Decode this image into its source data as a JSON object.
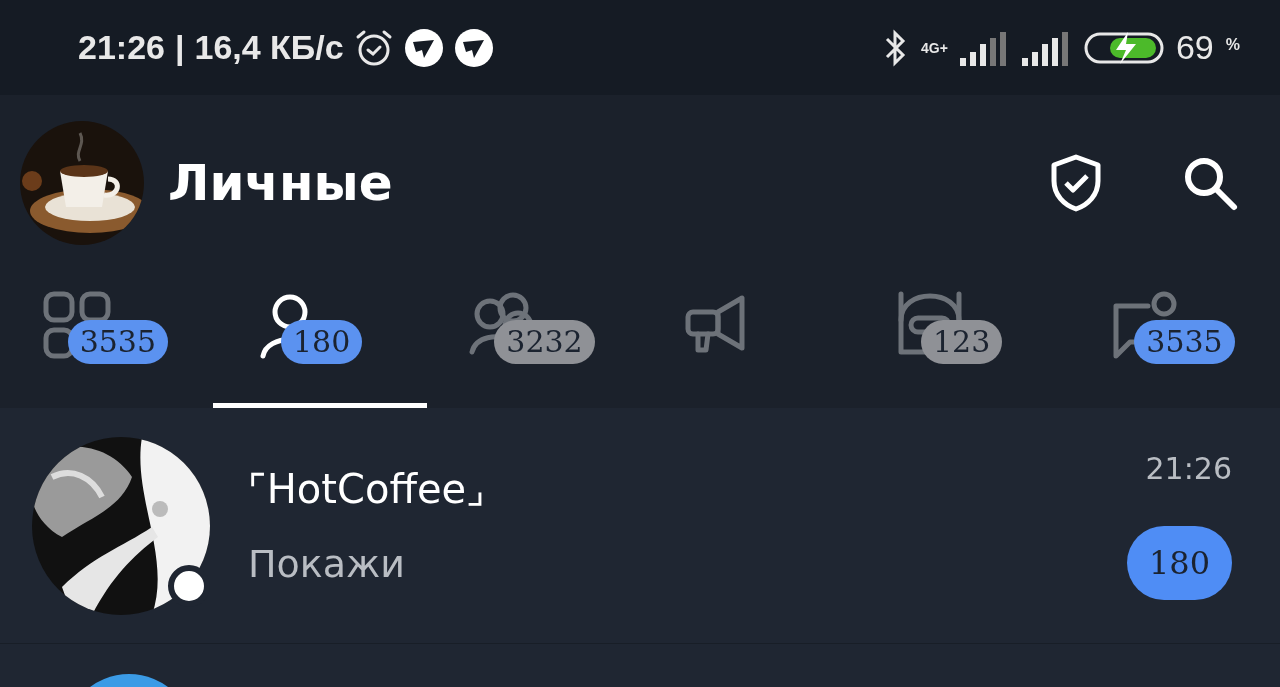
{
  "status_bar": {
    "time": "21:26",
    "separator": "|",
    "speed": "16,4 КБ/с",
    "network": "4G+",
    "battery": "69",
    "battery_unit": "%"
  },
  "header": {
    "title": "Личные"
  },
  "tabs": [
    {
      "kind": "all",
      "badge": "3535",
      "muted": false,
      "selected": false
    },
    {
      "kind": "person",
      "badge": "180",
      "muted": false,
      "selected": true
    },
    {
      "kind": "group",
      "badge": "3232",
      "muted": true,
      "selected": false
    },
    {
      "kind": "channel",
      "selected": false
    },
    {
      "kind": "bot",
      "badge": "123",
      "muted": true,
      "selected": false
    },
    {
      "kind": "chat",
      "badge": "3535",
      "muted": false,
      "selected": false
    }
  ],
  "chats": [
    {
      "name": "⌜HotCoffee⌟",
      "time": "21:26",
      "message": "Покажи",
      "unread": "180",
      "online": true
    }
  ]
}
